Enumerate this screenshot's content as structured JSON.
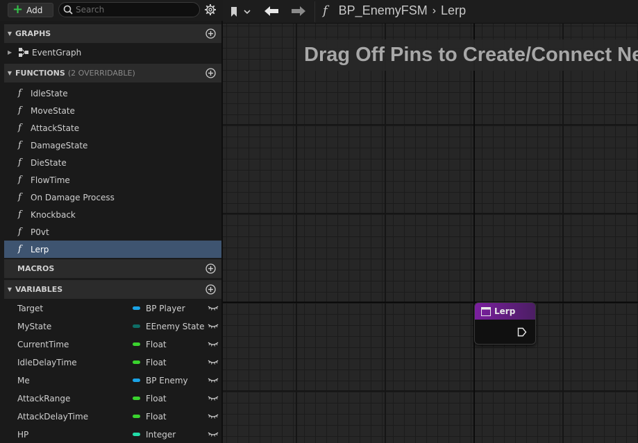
{
  "toolbar": {
    "add_label": "Add",
    "search_placeholder": "Search"
  },
  "sections": {
    "graphs": "GRAPHS",
    "functions": "FUNCTIONS",
    "functions_sub": "(2 OVERRIDABLE)",
    "macros": "MACROS",
    "variables": "VARIABLES"
  },
  "graphs": [
    {
      "label": "EventGraph"
    }
  ],
  "functions": [
    {
      "label": "IdleState"
    },
    {
      "label": "MoveState"
    },
    {
      "label": "AttackState"
    },
    {
      "label": "DamageState"
    },
    {
      "label": "DieState"
    },
    {
      "label": "FlowTime"
    },
    {
      "label": "On Damage Process"
    },
    {
      "label": "Knockback"
    },
    {
      "label": "P0vt"
    },
    {
      "label": "Lerp",
      "selected": true
    }
  ],
  "variables": [
    {
      "name": "Target",
      "type": "BP Player",
      "color": "#1aa3e6"
    },
    {
      "name": "MyState",
      "type": "EEnemy State",
      "color": "#0e6e66"
    },
    {
      "name": "CurrentTime",
      "type": "Float",
      "color": "#3ad32e"
    },
    {
      "name": "IdleDelayTime",
      "type": "Float",
      "color": "#3ad32e"
    },
    {
      "name": "Me",
      "type": "BP Enemy",
      "color": "#1aa3e6"
    },
    {
      "name": "AttackRange",
      "type": "Float",
      "color": "#3ad32e"
    },
    {
      "name": "AttackDelayTime",
      "type": "Float",
      "color": "#3ad32e"
    },
    {
      "name": "HP",
      "type": "Integer",
      "color": "#22dca8"
    }
  ],
  "breadcrumb": {
    "blueprint": "BP_EnemyFSM",
    "function": "Lerp"
  },
  "graph": {
    "hint": "Drag Off Pins to Create/Connect New Nodes.",
    "node_title": "Lerp",
    "node_color": "#7a1f9e"
  }
}
